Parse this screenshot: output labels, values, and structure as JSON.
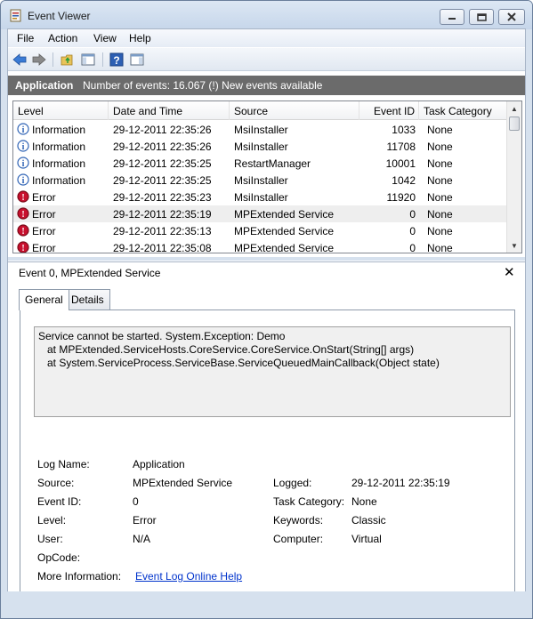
{
  "window": {
    "title": "Event Viewer"
  },
  "menu": [
    "File",
    "Action",
    "View",
    "Help"
  ],
  "toolbar": {
    "icons": [
      "back-arrow-icon",
      "forward-arrow-icon",
      "folder-up-icon",
      "show-hide-tree-icon",
      "help-icon",
      "show-hide-action-pane-icon"
    ]
  },
  "infobar": {
    "log_name": "Application",
    "count_text": "Number of events: 16.067 (!) New events available"
  },
  "grid": {
    "columns": [
      "Level",
      "Date and Time",
      "Source",
      "Event ID",
      "Task Category"
    ],
    "rows": [
      {
        "level": "Information",
        "date": "29-12-2011 22:35:26",
        "source": "MsiInstaller",
        "event_id": "1033",
        "category": "None",
        "type": "info"
      },
      {
        "level": "Information",
        "date": "29-12-2011 22:35:26",
        "source": "MsiInstaller",
        "event_id": "11708",
        "category": "None",
        "type": "info"
      },
      {
        "level": "Information",
        "date": "29-12-2011 22:35:25",
        "source": "RestartManager",
        "event_id": "10001",
        "category": "None",
        "type": "info"
      },
      {
        "level": "Information",
        "date": "29-12-2011 22:35:25",
        "source": "MsiInstaller",
        "event_id": "1042",
        "category": "None",
        "type": "info"
      },
      {
        "level": "Error",
        "date": "29-12-2011 22:35:23",
        "source": "MsiInstaller",
        "event_id": "11920",
        "category": "None",
        "type": "error"
      },
      {
        "level": "Error",
        "date": "29-12-2011 22:35:19",
        "source": "MPExtended Service",
        "event_id": "0",
        "category": "None",
        "type": "error"
      },
      {
        "level": "Error",
        "date": "29-12-2011 22:35:13",
        "source": "MPExtended Service",
        "event_id": "0",
        "category": "None",
        "type": "error"
      },
      {
        "level": "Error",
        "date": "29-12-2011 22:35:08",
        "source": "MPExtended Service",
        "event_id": "0",
        "category": "None",
        "type": "error"
      }
    ],
    "selected_index": 5
  },
  "detail": {
    "title": "Event 0, MPExtended Service",
    "close_glyph": "✕",
    "tabs": [
      "General",
      "Details"
    ],
    "message_lines": [
      "Service cannot be started. System.Exception: Demo",
      "   at MPExtended.ServiceHosts.CoreService.CoreService.OnStart(String[] args)",
      "   at System.ServiceProcess.ServiceBase.ServiceQueuedMainCallback(Object state)"
    ],
    "props": {
      "log_name_label": "Log Name:",
      "log_name": "Application",
      "source_label": "Source:",
      "source": "MPExtended Service",
      "logged_label": "Logged:",
      "logged": "29-12-2011 22:35:19",
      "event_id_label": "Event ID:",
      "event_id": "0",
      "task_category_label": "Task Category:",
      "task_category": "None",
      "level_label": "Level:",
      "level": "Error",
      "keywords_label": "Keywords:",
      "keywords": "Classic",
      "user_label": "User:",
      "user": "N/A",
      "computer_label": "Computer:",
      "computer": "Virtual",
      "opcode_label": "OpCode:",
      "opcode": "",
      "more_info_label": "More Information:",
      "more_info_link": "Event Log Online Help"
    }
  },
  "colors": {
    "info_icon": "#2f63b5",
    "error_icon": "#c8102e",
    "infobar_bg": "#6b6b6b",
    "link": "#0033cc"
  }
}
